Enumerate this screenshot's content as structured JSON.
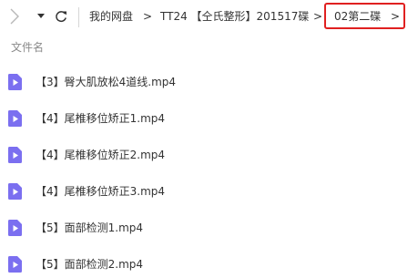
{
  "toolbar": {
    "forward_icon": "chevron-right-icon",
    "history_icon": "caret-down-icon",
    "refresh_icon": "refresh-icon"
  },
  "breadcrumb": {
    "root": "我的网盘",
    "separator": ">",
    "folder": "TT24 【仝氏整形】201517碟",
    "current": "02第二碟"
  },
  "list": {
    "column_header": "文件名",
    "icon_color": "#7b6ff0",
    "files": [
      {
        "name": "【3】臀大肌放松4道线.mp4"
      },
      {
        "name": "【4】尾椎移位矫正1.mp4"
      },
      {
        "name": "【4】尾椎移位矫正2.mp4"
      },
      {
        "name": "【4】尾椎移位矫正3.mp4"
      },
      {
        "name": "【5】面部检测1.mp4"
      },
      {
        "name": "【5】面部检测2.mp4"
      }
    ]
  },
  "highlight_color": "#e02020"
}
